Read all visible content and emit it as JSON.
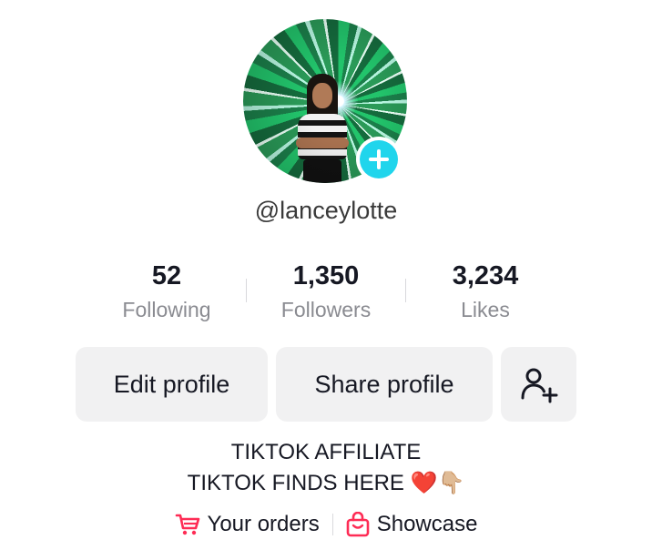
{
  "profile": {
    "username": "@lanceylotte",
    "avatar_icon": "profile-photo",
    "add_icon": "plus-icon",
    "accent_color": "#20d5ec"
  },
  "stats": [
    {
      "value": "52",
      "label": "Following"
    },
    {
      "value": "1,350",
      "label": "Followers"
    },
    {
      "value": "3,234",
      "label": "Likes"
    }
  ],
  "actions": {
    "edit_label": "Edit profile",
    "share_label": "Share profile",
    "add_friend_icon": "add-friend-icon"
  },
  "bio": {
    "line1": "TIKTOK AFFILIATE",
    "line2": "TIKTOK FINDS HERE ❤️👇🏼"
  },
  "links": {
    "orders_label": "Your orders",
    "orders_icon": "cart-icon",
    "showcase_label": "Showcase",
    "showcase_icon": "shopping-bag-icon",
    "icon_color": "#fe2c55"
  }
}
